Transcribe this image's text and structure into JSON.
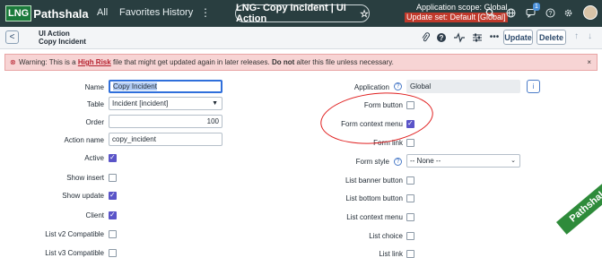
{
  "topbar": {
    "logo_mark": "LNG",
    "logo_text": "Pathshala",
    "nav": [
      "All",
      "Favorites",
      "History"
    ],
    "more": "⋮",
    "title": "LNG- Copy Incident | UI Action",
    "star": "☆",
    "scope_line1": "Application scope: Global",
    "scope_line2": "Update set: Default [Global]",
    "notification_count": "1"
  },
  "form_header": {
    "back": "<",
    "line1": "UI Action",
    "line2": "Copy Incident",
    "update_label": "Update",
    "delete_label": "Delete",
    "up": "↑",
    "down": "↓"
  },
  "warning": {
    "icon": "⊗",
    "prefix": "Warning: This is a ",
    "high_risk": "High Risk",
    "middle": " file that might get updated again in later releases. ",
    "do_not": "Do not",
    "suffix": " alter this file unless necessary.",
    "close": "×"
  },
  "left_fields": {
    "name_label": "Name",
    "name_value": "Copy Incident",
    "table_label": "Table",
    "table_value": "Incident [incident]",
    "order_label": "Order",
    "order_value": "100",
    "action_name_label": "Action name",
    "action_name_value": "copy_incident",
    "active_label": "Active",
    "show_insert_label": "Show insert",
    "show_update_label": "Show update",
    "client_label": "Client",
    "list_v2_label": "List v2 Compatible",
    "list_v3_label": "List v3 Compatible"
  },
  "right_fields": {
    "application_label": "Application",
    "application_value": "Global",
    "form_button_label": "Form button",
    "form_context_menu_label": "Form context menu",
    "form_link_label": "Form link",
    "form_style_label": "Form style",
    "form_style_value": "-- None --",
    "list_banner_button_label": "List banner button",
    "list_bottom_button_label": "List bottom button",
    "list_context_menu_label": "List context menu",
    "list_choice_label": "List choice",
    "list_link_label": "List link"
  },
  "checkbox_state": {
    "active": true,
    "show_insert": false,
    "show_update": true,
    "client": true,
    "list_v2": false,
    "list_v3": false,
    "form_button": false,
    "form_context_menu": true,
    "form_link": false,
    "list_banner_button": false,
    "list_bottom_button": false,
    "list_context_menu": false,
    "list_choice": false,
    "list_link": false
  },
  "ribbon_text": "Pathshala",
  "colors": {
    "topbar": "#293e40",
    "accent": "#2f6fdb",
    "checkbox_checked": "#5a54c8",
    "warning_bg": "#f7d4d4",
    "annotation": "#e02020"
  }
}
